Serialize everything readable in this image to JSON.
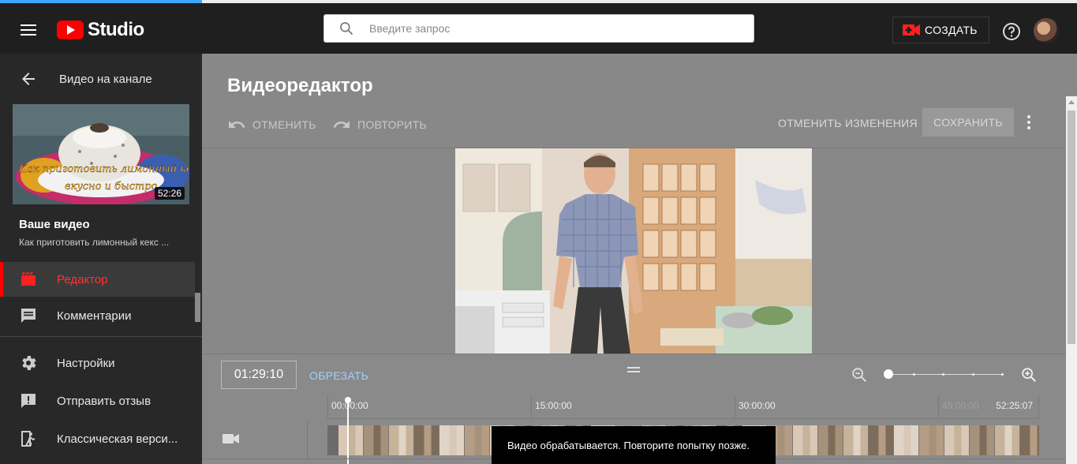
{
  "topbar": {
    "logo_text": "Studio",
    "search_placeholder": "Введите запрос",
    "create_label": "СОЗДАТЬ"
  },
  "sidebar": {
    "back_label": "Видео на канале",
    "thumbnail": {
      "duration": "52:26",
      "caption_line1": "Как приготовить лимонный кекс",
      "caption_line2": "вкусно и быстро"
    },
    "your_video_title": "Ваше видео",
    "video_subtitle": "Как приготовить лимонный кекс ...",
    "items": [
      {
        "label": "Редактор",
        "icon": "clapperboard-icon",
        "active": true
      },
      {
        "label": "Комментарии",
        "icon": "comment-icon",
        "active": false
      },
      {
        "label": "Настройки",
        "icon": "gear-icon",
        "active": false
      },
      {
        "label": "Отправить отзыв",
        "icon": "feedback-icon",
        "active": false
      },
      {
        "label": "Классическая верси...",
        "icon": "classic-exit-icon",
        "active": false
      }
    ]
  },
  "editor": {
    "title": "Видеоредактор",
    "undo_label": "ОТМЕНИТЬ",
    "redo_label": "ПОВТОРИТЬ",
    "discard_label": "ОТМЕНИТЬ ИЗМЕНЕНИЯ",
    "save_label": "СОХРАНИТЬ",
    "current_time": "01:29:10",
    "trim_label": "ОБРЕЗАТЬ",
    "ruler": {
      "marks": [
        "00:00:00",
        "15:00:00",
        "30:00:00",
        "45:00:00"
      ],
      "end": "52:25:07"
    }
  },
  "toast": {
    "message": "Видео обрабатывается. Повторите попытку позже."
  },
  "colors": {
    "accent_red": "#ff0000",
    "link_blue": "#9fd0ff",
    "topbar_bg": "#1f1f1f",
    "sidebar_bg": "#282828",
    "main_overlay_bg": "#888888"
  }
}
